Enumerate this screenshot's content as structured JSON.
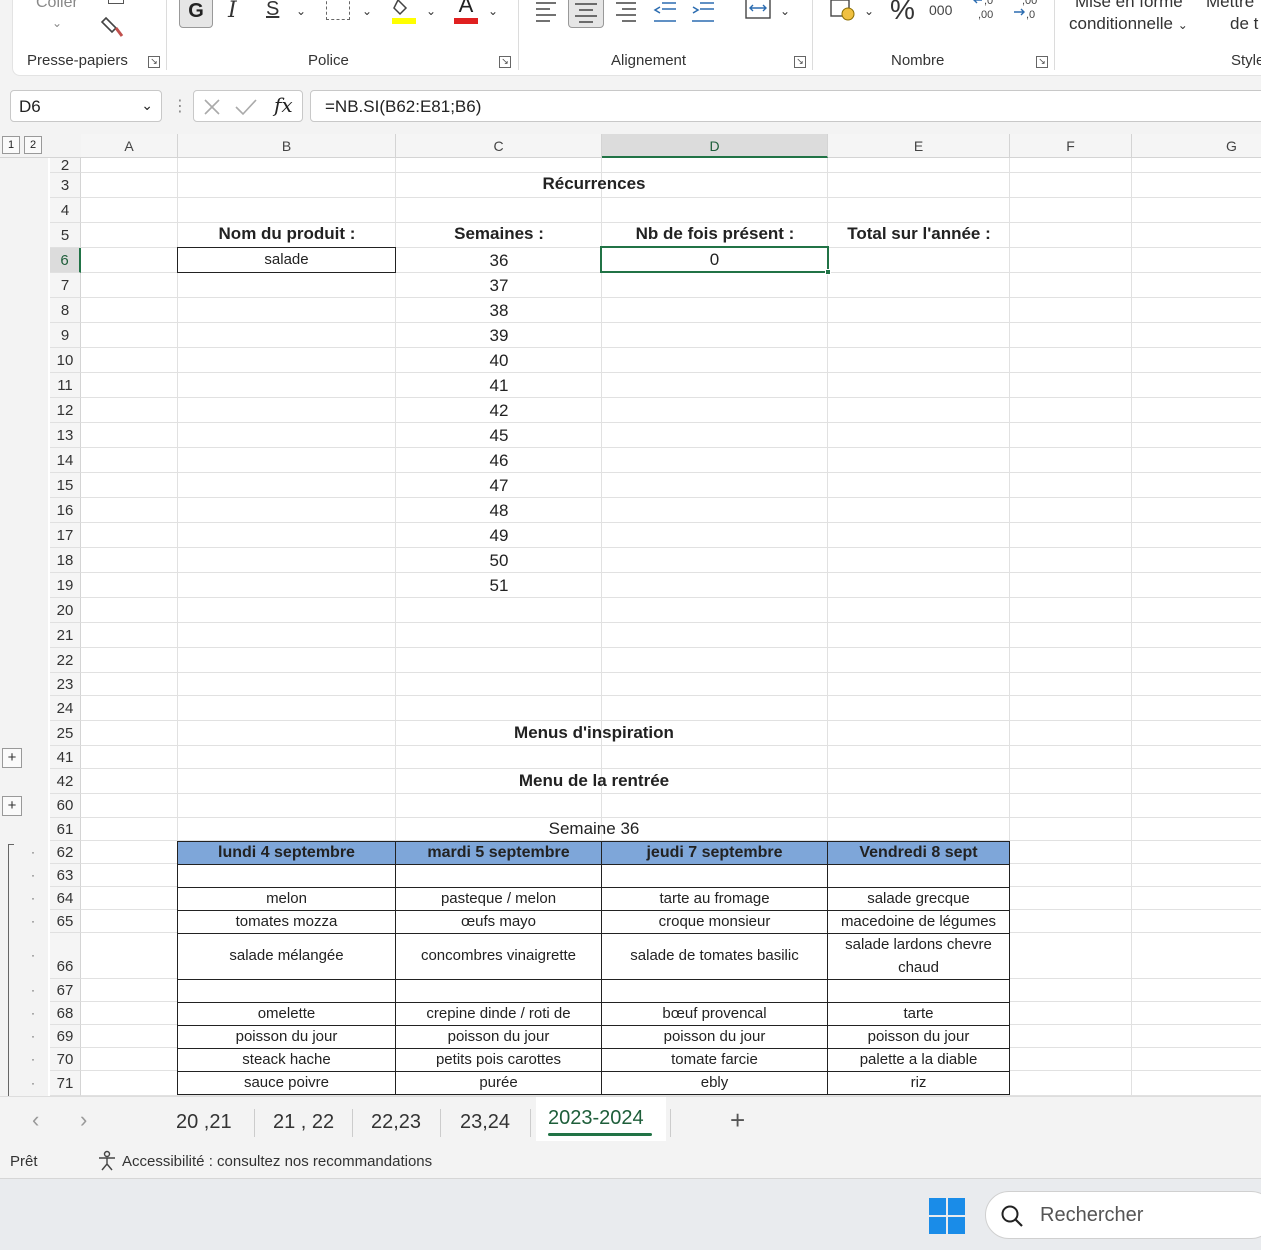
{
  "ribbon": {
    "coller": "Coller",
    "groups": {
      "clipboard": "Presse-papiers",
      "font": "Police",
      "alignment": "Alignement",
      "number": "Nombre",
      "styles": "Style"
    },
    "bold_glyph": "G",
    "italic_glyph": "I",
    "underline_glyph": "S",
    "font_color_glyph": "A",
    "percent_glyph": "%",
    "thousands_glyph": "000",
    "mise_en_forme_line1": "Mise en forme",
    "mise_en_forme_line2": "conditionnelle",
    "mettre_line1": "Mettre",
    "mettre_line2": "de t"
  },
  "formula_bar": {
    "name_box": "D6",
    "formula": "=NB.SI(B62:E81;B6)",
    "fx": "fx"
  },
  "outline_levels": [
    "1",
    "2"
  ],
  "columns": [
    "A",
    "B",
    "C",
    "D",
    "E",
    "F",
    "G"
  ],
  "rows": [
    "2",
    "3",
    "4",
    "5",
    "6",
    "7",
    "8",
    "9",
    "10",
    "11",
    "12",
    "13",
    "14",
    "15",
    "16",
    "17",
    "18",
    "19",
    "20",
    "21",
    "22",
    "23",
    "24",
    "25",
    "41",
    "42",
    "60",
    "61",
    "62",
    "63",
    "64",
    "65",
    "66",
    "67",
    "68",
    "69",
    "70",
    "71"
  ],
  "sheet": {
    "title_recurrences": "Récurrences",
    "header_nom": "Nom du produit :",
    "header_semaines": "Semaines :",
    "header_nb": "Nb de fois présent :",
    "header_total": "Total sur l'année :",
    "product_value": "salade",
    "count_value": "0",
    "weeks": [
      "36",
      "37",
      "38",
      "39",
      "40",
      "41",
      "42",
      "45",
      "46",
      "47",
      "48",
      "49",
      "50",
      "51"
    ],
    "menus_inspiration": "Menus d'inspiration",
    "menu_rentree": "Menu de la rentrée",
    "semaine_36": "Semaine 36"
  },
  "menu_table": {
    "headers": [
      "lundi 4  septembre",
      "mardi 5 septembre",
      "jeudi 7 septembre",
      "Vendredi 8 sept"
    ],
    "rows": [
      [
        "",
        "",
        "",
        ""
      ],
      [
        "melon",
        "pasteque / melon",
        "tarte au fromage",
        "salade grecque"
      ],
      [
        "tomates mozza",
        "œufs mayo",
        "croque monsieur",
        "macedoine de légumes"
      ],
      [
        "salade mélangée",
        "concombres vinaigrette",
        "salade de  tomates basilic",
        "salade lardons chevre chaud"
      ],
      [
        "",
        "",
        "",
        ""
      ],
      [
        "omelette",
        "crepine dinde  / roti de",
        "bœuf provencal",
        "tarte"
      ],
      [
        "poisson du jour",
        "poisson du jour",
        "poisson du jour",
        "poisson du jour"
      ],
      [
        "steack hache",
        "petits pois carottes",
        "tomate farcie",
        "palette a la diable"
      ],
      [
        "sauce poivre",
        "purée",
        "ebly",
        "riz"
      ]
    ],
    "header_color": "#7ea6d9"
  },
  "tabs": [
    "20  ,21",
    "21 , 22",
    "22,23",
    "23,24",
    "2023-2024"
  ],
  "active_tab": "2023-2024",
  "add_sheet": "+",
  "status": {
    "ready": "Prêt",
    "accessibility": "Accessibilité : consultez nos recommandations"
  },
  "taskbar": {
    "search_placeholder": "Rechercher"
  },
  "colors": {
    "accent": "#217346",
    "header_fill": "#7ea6d9"
  }
}
